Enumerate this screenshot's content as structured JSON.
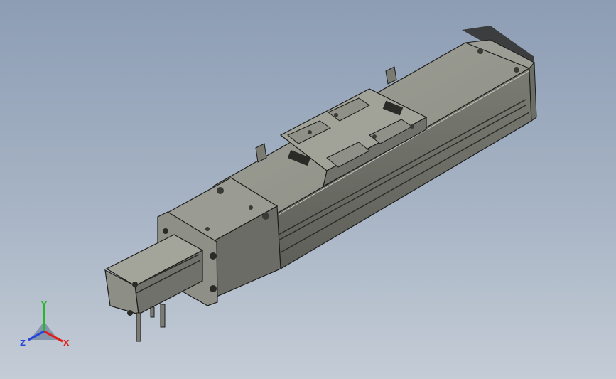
{
  "viewport": {
    "background_top": "#8d9db4",
    "background_bottom": "#c4ccd6"
  },
  "model": {
    "body_color": "#8a8c84",
    "edge_color": "#1c1c1a"
  },
  "triad": {
    "x_label": "X",
    "y_label": "Y",
    "z_label": "Z",
    "x_color": "#e0201c",
    "y_color": "#27b62a",
    "z_color": "#2846d8"
  }
}
